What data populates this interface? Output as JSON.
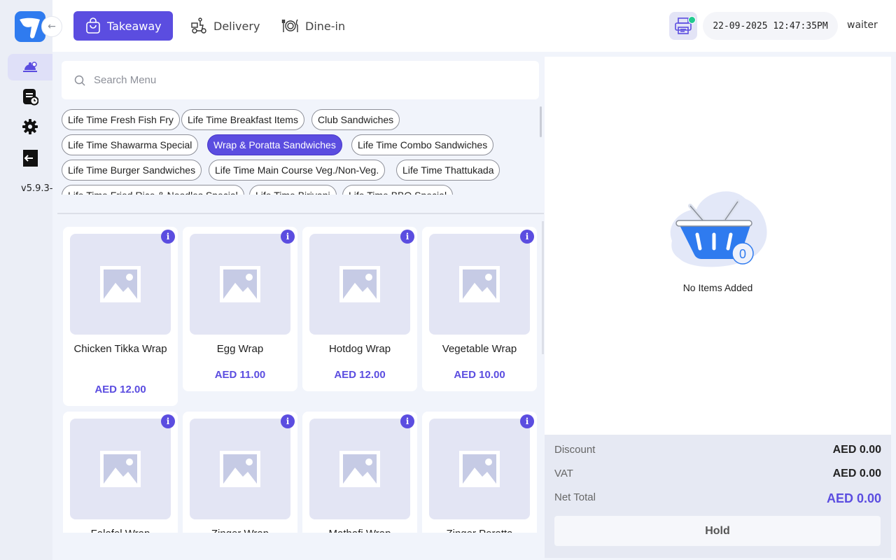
{
  "app": {
    "version": "v5.9.3-",
    "logo_icon": "logo-icon"
  },
  "sidebar": {
    "items": [
      {
        "name": "waiter-icon",
        "active": true
      },
      {
        "name": "orders-history-icon",
        "active": false
      },
      {
        "name": "gear-icon",
        "active": false
      },
      {
        "name": "logout-icon",
        "active": false
      }
    ]
  },
  "header": {
    "order_types": [
      {
        "label": "Takeaway",
        "icon": "shopping-bag-icon",
        "active": true
      },
      {
        "label": "Delivery",
        "icon": "delivery-scooter-icon",
        "active": false
      },
      {
        "label": "Dine-in",
        "icon": "dine-in-icon",
        "active": false
      }
    ],
    "datetime": "22-09-2025 12:47:35PM",
    "user": "waiter"
  },
  "search": {
    "placeholder": "Search Menu",
    "value": ""
  },
  "categories": [
    "Life Time Fresh Fish Fry",
    "Life Time Breakfast Items",
    "Club Sandwiches",
    "Life Time Shawarma Special",
    "Wrap & Poratta Sandwiches",
    "Life Time Combo Sandwiches",
    "Life Time Burger Sandwiches",
    "Life Time Main Course Veg./Non-Veg.",
    "Life Time Thattukada",
    "Life Time Fried Rice & Noodles Special",
    "Life Time Biriyani",
    "Life Time BBQ Special"
  ],
  "active_category": "Wrap & Poratta Sandwiches",
  "items": [
    {
      "name": "Chicken Tikka Wrap",
      "price": "AED 12.00"
    },
    {
      "name": "Egg Wrap",
      "price": "AED 11.00"
    },
    {
      "name": "Hotdog Wrap",
      "price": "AED 12.00"
    },
    {
      "name": "Vegetable Wrap",
      "price": "AED 10.00"
    },
    {
      "name": "Falafel Wrap",
      "price": ""
    },
    {
      "name": "Zinger Wrap",
      "price": ""
    },
    {
      "name": "Mathafi Wrap",
      "price": ""
    },
    {
      "name": "Zinger Poratta",
      "price": ""
    }
  ],
  "cart": {
    "count": "0",
    "empty_text": "No Items Added",
    "icon": "basket-icon",
    "discount_label": "Discount",
    "discount_value": "AED 0.00",
    "vat_label": "VAT",
    "vat_value": "AED 0.00",
    "net_label": "Net Total",
    "net_value": "AED 0.00",
    "hold_label": "Hold"
  },
  "colors": {
    "accent": "#5b4de0",
    "brand_blue": "#2f7bef",
    "online_green": "#21c98f"
  }
}
